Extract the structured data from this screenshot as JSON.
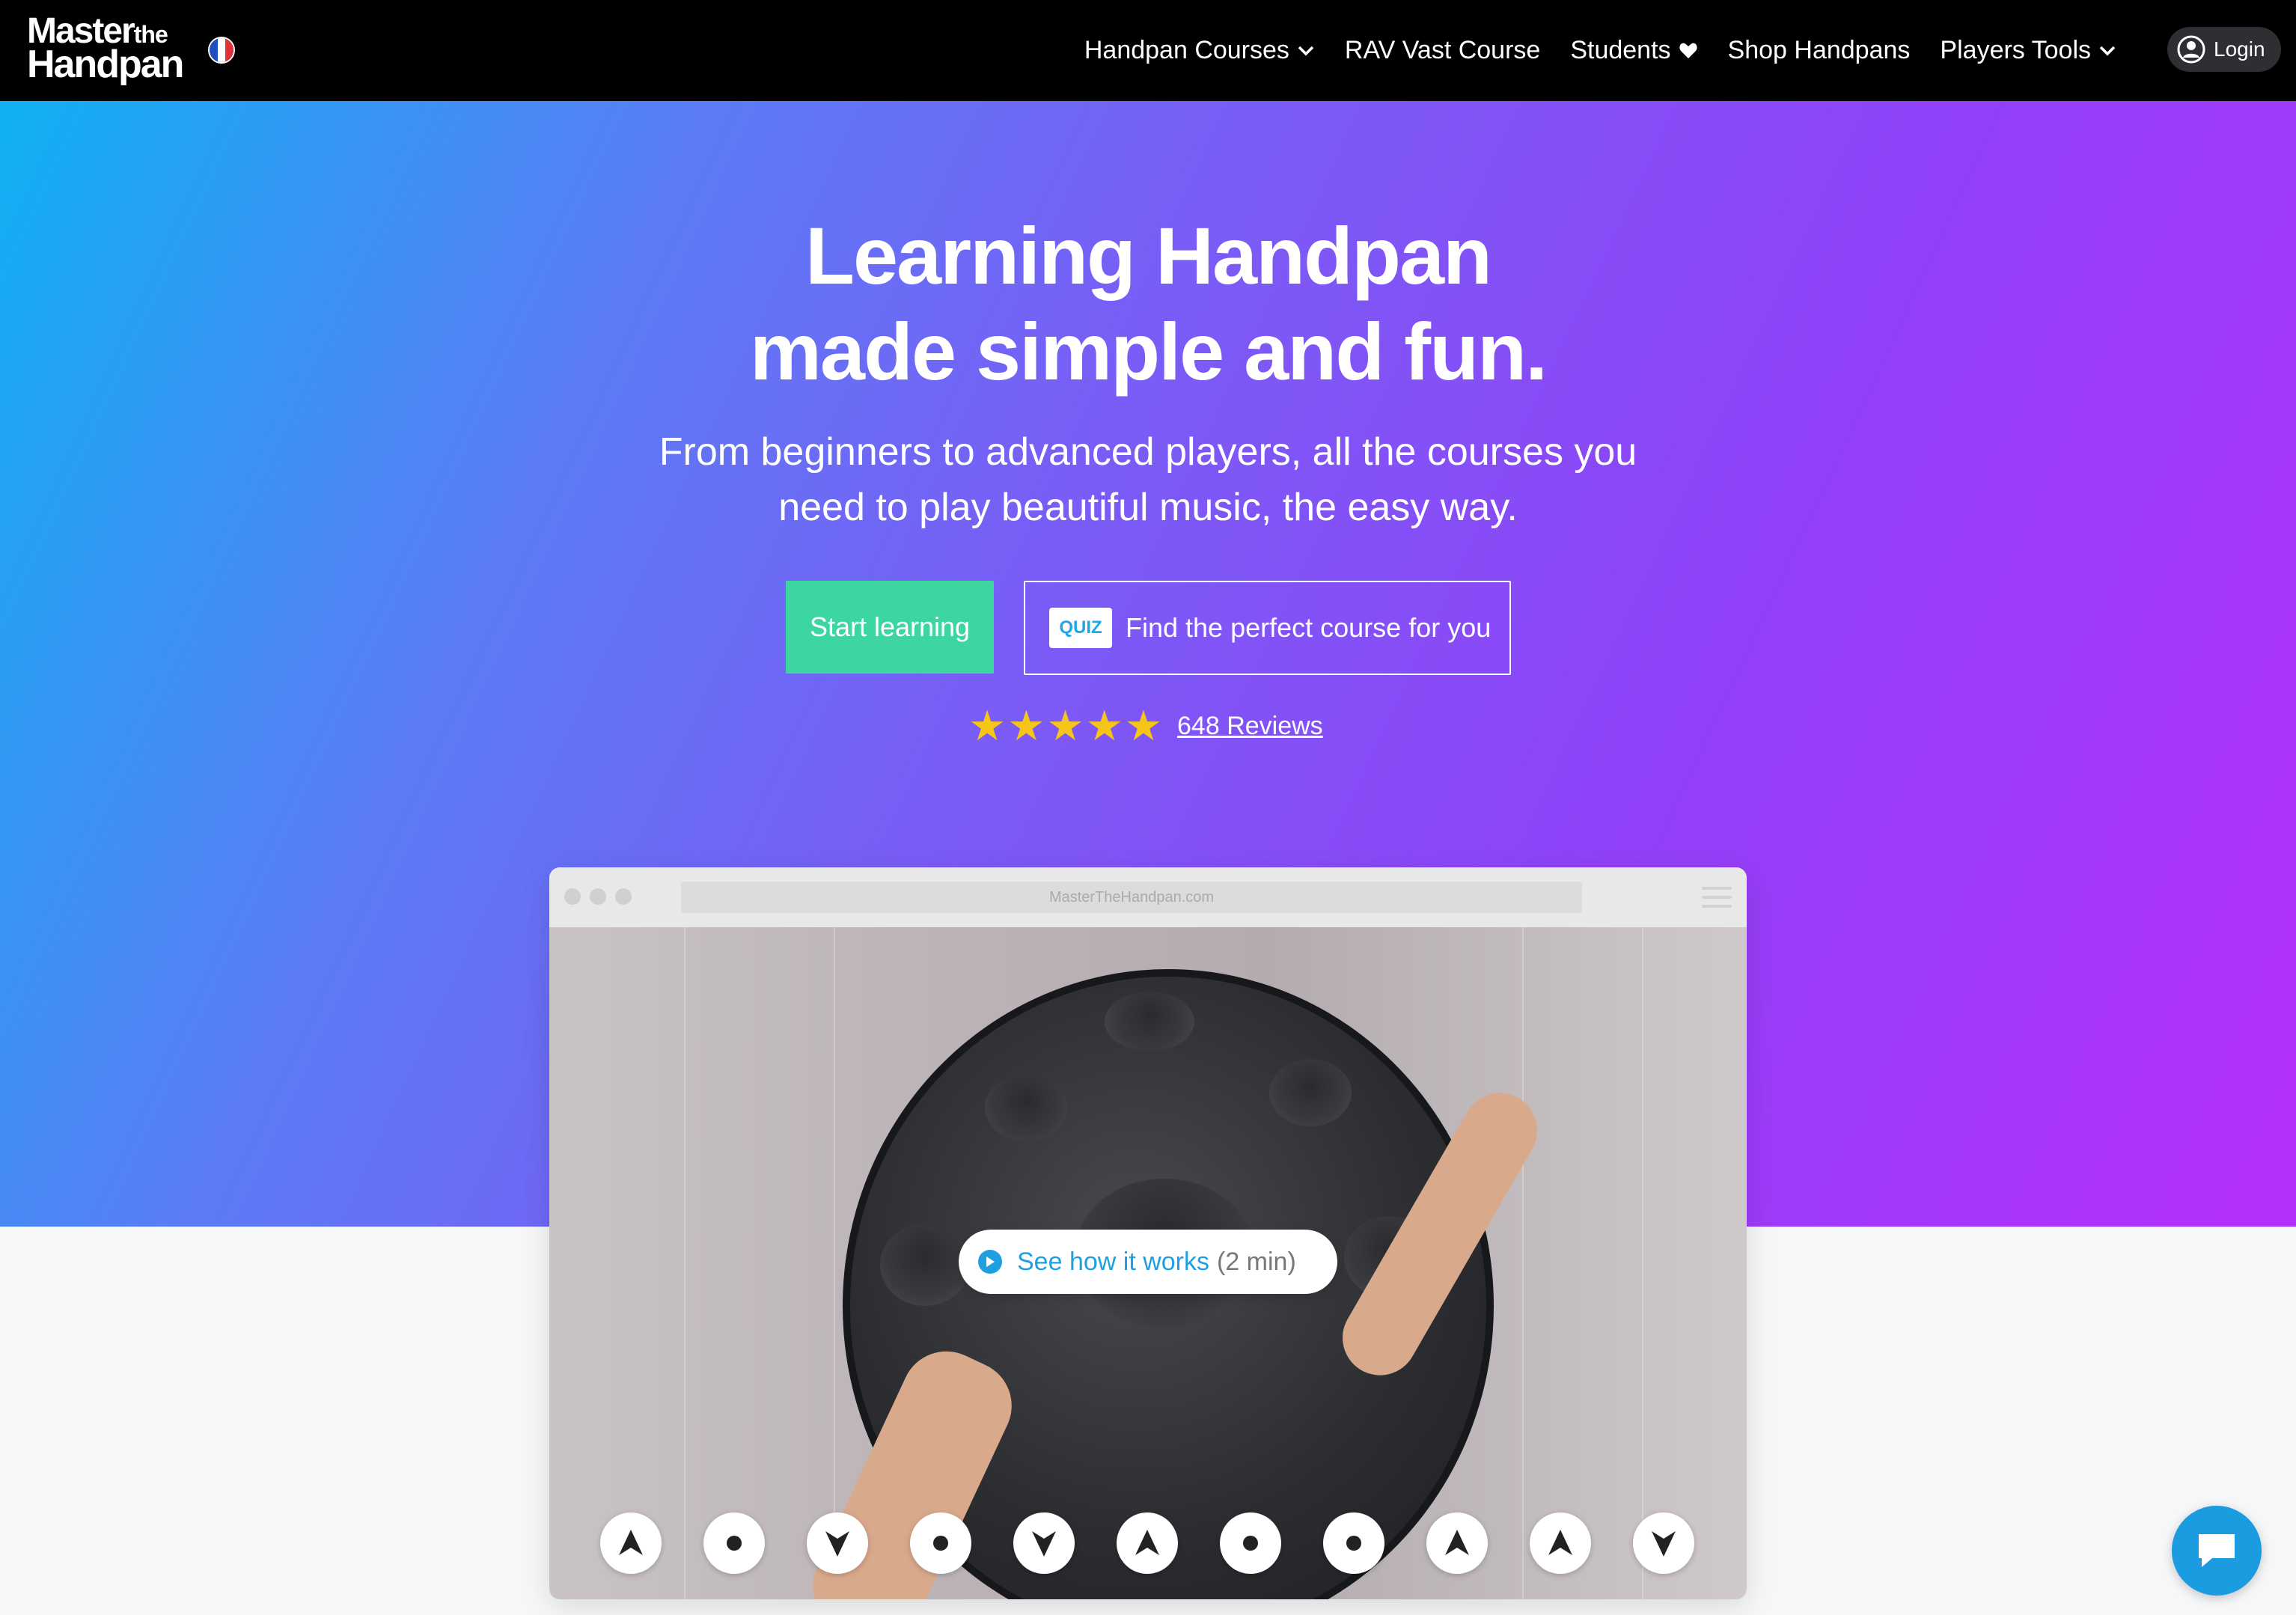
{
  "brand": {
    "line1": "Master",
    "line1_small": "the",
    "line2": "Handpan"
  },
  "colors": {
    "accent_green": "#3ed6a0",
    "brand_blue": "#1ea0e0",
    "gradient_start": "#0fb0f2",
    "gradient_end": "#b530fb"
  },
  "nav": {
    "items": [
      {
        "label": "Handpan Courses",
        "icon": "chevron-down-icon"
      },
      {
        "label": "RAV Vast Course",
        "icon": ""
      },
      {
        "label": "Students",
        "icon": "heart-icon"
      },
      {
        "label": "Shop Handpans",
        "icon": ""
      },
      {
        "label": "Players Tools",
        "icon": "chevron-down-icon"
      }
    ],
    "login_label": "Login"
  },
  "hero": {
    "title_line1": "Learning Handpan",
    "title_line2": "made simple and fun.",
    "subtitle_line1": "From beginners to advanced players, all the courses you",
    "subtitle_line2": "need to play beautiful music, the easy way.",
    "start_button": "Start learning",
    "quiz_badge": "QUIZ",
    "quiz_button": "Find the perfect course for you",
    "rating_stars": 5,
    "reviews_link": "648 Reviews"
  },
  "mockup": {
    "url": "MasterTheHandpan.com",
    "play_label": "See how it works",
    "play_duration": "(2 min)",
    "notes": [
      "arrow-up",
      "dot",
      "arrow-down",
      "dot",
      "arrow-down",
      "arrow-up",
      "dot",
      "dot",
      "arrow-up",
      "arrow-up",
      "arrow-down"
    ]
  }
}
